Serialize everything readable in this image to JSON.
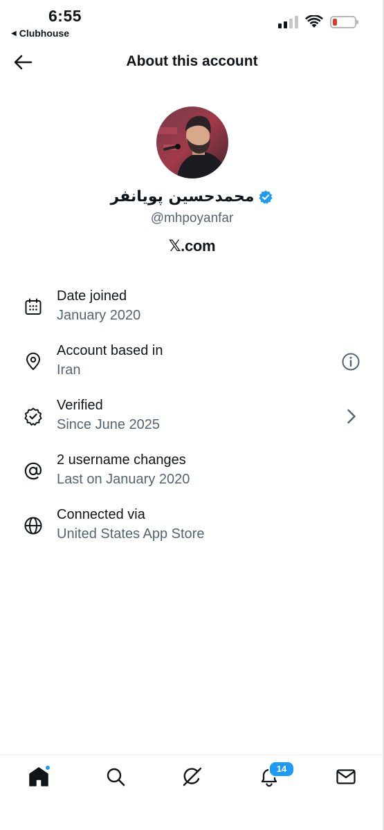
{
  "status_bar": {
    "time": "6:55",
    "back_app": "Clubhouse",
    "back_glyph": "◀"
  },
  "header": {
    "title": "About this account"
  },
  "profile": {
    "display_name": "محمدحسین پویانفر",
    "handle": "@mhpoyanfar",
    "platform": "𝕏.com",
    "verified": true
  },
  "info_rows": [
    {
      "icon": "calendar-icon",
      "title": "Date joined",
      "subtitle": "January 2020"
    },
    {
      "icon": "location-pin-icon",
      "title": "Account based in",
      "subtitle": "Iran",
      "action": "info-icon"
    },
    {
      "icon": "verified-badge-icon",
      "title": "Verified",
      "subtitle": "Since June 2025",
      "action": "chevron-right-icon"
    },
    {
      "icon": "at-sign-icon",
      "title": "2 username changes",
      "subtitle": "Last on January 2020"
    },
    {
      "icon": "globe-icon",
      "title": "Connected via",
      "subtitle": "United States App Store"
    }
  ],
  "bottom_nav": {
    "items": [
      {
        "icon": "home-icon",
        "active": true,
        "has_dot": true
      },
      {
        "icon": "search-icon"
      },
      {
        "icon": "grok-icon"
      },
      {
        "icon": "bell-icon",
        "badge": "14"
      },
      {
        "icon": "mail-icon"
      }
    ]
  },
  "colors": {
    "text_primary": "#0f1419",
    "text_secondary": "#536471",
    "accent": "#1d9bf0",
    "battery_low": "#e0382f"
  }
}
